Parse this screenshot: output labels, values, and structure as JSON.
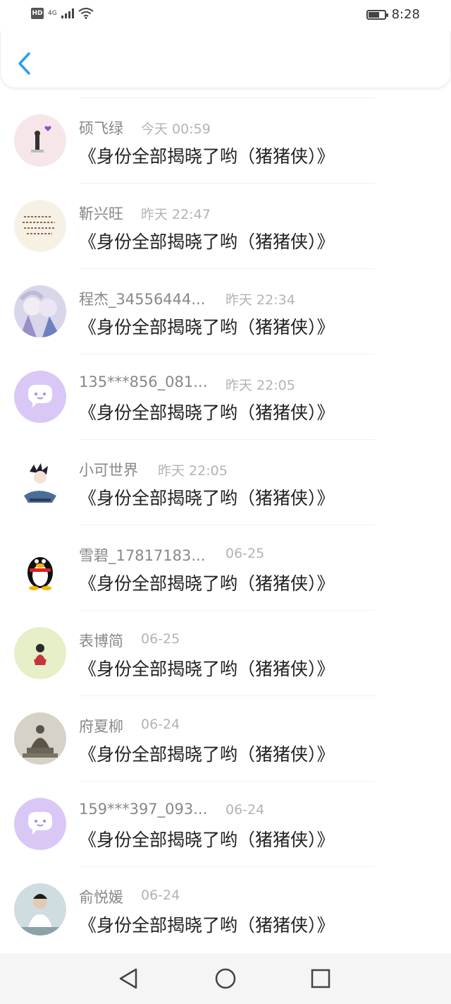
{
  "status_bar": {
    "hd": "HD",
    "network": "4G",
    "time": "8:28",
    "battery_level": 0.7
  },
  "colors": {
    "accent": "#2d9cf0",
    "name": "#888888",
    "time": "#b3b3b3",
    "message": "#222222"
  },
  "messages": [
    {
      "name": "硕飞绿",
      "time": "今天 00:59",
      "text": "《身份全部揭晓了哟（猪猪侠）》",
      "avatar": "avatar-girl-pink"
    },
    {
      "name": "靳兴旺",
      "time": "昨天 22:47",
      "text": "《身份全部揭晓了哟（猪猪侠）》",
      "avatar": "avatar-handwriting"
    },
    {
      "name": "程杰_34556444...",
      "time": "昨天 22:34",
      "text": "《身份全部揭晓了哟（猪猪侠）》",
      "avatar": "avatar-anime-girls"
    },
    {
      "name": "135***856_081...",
      "time": "昨天 22:05",
      "text": "《身份全部揭晓了哟（猪猪侠）》",
      "avatar": "avatar-default-chat"
    },
    {
      "name": "小可世界",
      "time": "昨天 22:05",
      "text": "《身份全部揭晓了哟（猪猪侠）》",
      "avatar": "avatar-anime-boy"
    },
    {
      "name": "雪碧_17817183...",
      "time": "06-25",
      "text": "《身份全部揭晓了哟（猪猪侠）》",
      "avatar": "avatar-qq-penguin"
    },
    {
      "name": "表博简",
      "time": "06-25",
      "text": "《身份全部揭晓了哟（猪猪侠）》",
      "avatar": "avatar-girl-red"
    },
    {
      "name": "府夏柳",
      "time": "06-24",
      "text": "《身份全部揭晓了哟（猪猪侠）》",
      "avatar": "avatar-buddha"
    },
    {
      "name": "159***397_093...",
      "time": "06-24",
      "text": "《身份全部揭晓了哟（猪猪侠）》",
      "avatar": "avatar-default-chat"
    },
    {
      "name": "俞悦媛",
      "time": "06-24",
      "text": "《身份全部揭晓了哟（猪猪侠）》",
      "avatar": "avatar-boy-photo"
    }
  ],
  "nav": {
    "back": "back-triangle-icon",
    "home": "home-circle-icon",
    "recent": "recents-square-icon"
  }
}
